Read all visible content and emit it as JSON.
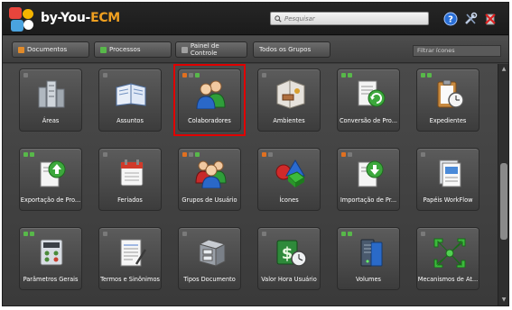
{
  "app": {
    "brand_prefix": "by-You",
    "brand_sep": "-",
    "brand_suffix": "ECM"
  },
  "search": {
    "placeholder": "Pesquisar"
  },
  "top_icons": [
    "help-icon",
    "tools-icon",
    "exit-icon"
  ],
  "menu": {
    "items": [
      {
        "label": "Documentos",
        "color": "#e08a2a"
      },
      {
        "label": "Processos",
        "color": "#58b84a"
      },
      {
        "label": "Painel de Controle",
        "color": "#a0a0a0"
      },
      {
        "label": "Todos os Grupos",
        "color": ""
      }
    ],
    "filter_placeholder": "Filtrar ícones"
  },
  "tiles": [
    {
      "label": "Áreas",
      "icon": "buildings-icon",
      "dots": [
        "#7a7a7a"
      ]
    },
    {
      "label": "Assuntos",
      "icon": "book-icon",
      "dots": [
        "#7a7a7a"
      ]
    },
    {
      "label": "Colaboradores",
      "icon": "users-icon",
      "dots": [
        "#e07020",
        "#7a7a7a",
        "#58b84a"
      ],
      "selected": true
    },
    {
      "label": "Ambientes",
      "icon": "room-icon",
      "dots": [
        "#7a7a7a"
      ]
    },
    {
      "label": "Conversão de Pro...",
      "icon": "convert-icon",
      "dots": [
        "#58b84a",
        "#58b84a"
      ]
    },
    {
      "label": "Expedientes",
      "icon": "clipboard-icon",
      "dots": [
        "#58b84a",
        "#58b84a"
      ]
    },
    {
      "label": "Exportação de Pro...",
      "icon": "export-icon",
      "dots": [
        "#58b84a",
        "#58b84a"
      ]
    },
    {
      "label": "Feriados",
      "icon": "calendar-icon",
      "dots": [
        "#7a7a7a"
      ]
    },
    {
      "label": "Grupos de Usuário",
      "icon": "user-group-icon",
      "dots": [
        "#e07020",
        "#7a7a7a",
        "#58b84a"
      ]
    },
    {
      "label": "Ícones",
      "icon": "shapes-icon",
      "dots": [
        "#e07020",
        "#7a7a7a"
      ]
    },
    {
      "label": "Importação de Pr...",
      "icon": "import-icon",
      "dots": [
        "#e07020",
        "#7a7a7a"
      ]
    },
    {
      "label": "Papéis WorkFlow",
      "icon": "papers-icon",
      "dots": [
        "#7a7a7a"
      ]
    },
    {
      "label": "Parâmetros Gerais",
      "icon": "settings-panel-icon",
      "dots": [
        "#58b84a",
        "#58b84a"
      ]
    },
    {
      "label": "Termos e Sinônimos",
      "icon": "document-icon",
      "dots": [
        "#7a7a7a"
      ]
    },
    {
      "label": "Tipos Documento",
      "icon": "file-cabinet-icon",
      "dots": [
        "#7a7a7a"
      ]
    },
    {
      "label": "Valor Hora Usuário",
      "icon": "money-clock-icon",
      "dots": [
        "#7a7a7a"
      ]
    },
    {
      "label": "Volumes",
      "icon": "server-icon",
      "dots": [
        "#58b84a",
        "#58b84a"
      ]
    },
    {
      "label": "Mecanismos de At...",
      "icon": "arrows-icon",
      "dots": [
        "#7a7a7a"
      ]
    }
  ]
}
